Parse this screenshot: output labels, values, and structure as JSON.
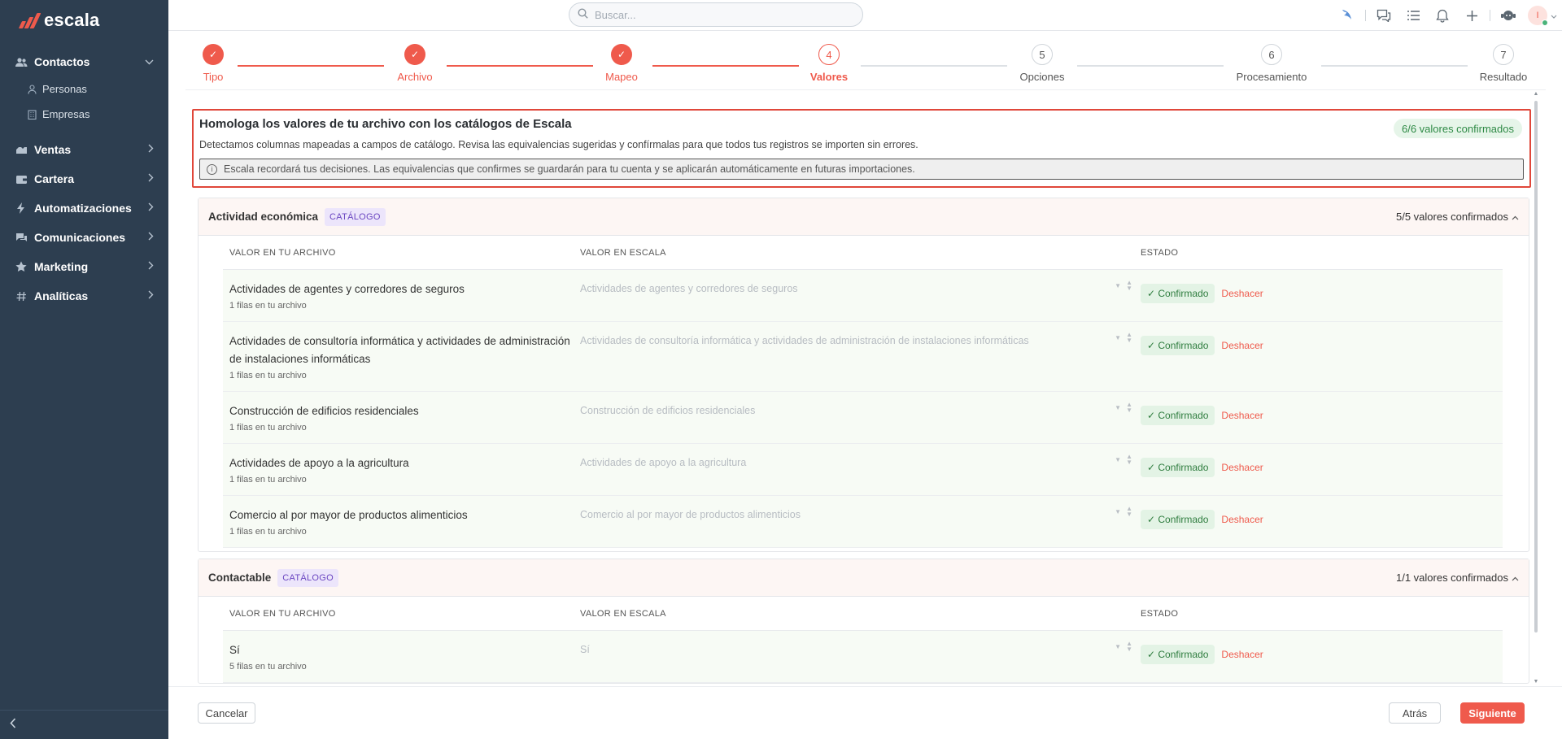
{
  "app": {
    "name": "escala",
    "accent": "#ef5a4c",
    "sidebar_bg": "#2d3e50"
  },
  "sidebar": {
    "items": [
      {
        "label": "Contactos",
        "icon": "users-icon",
        "chevron": "⌄",
        "children": [
          {
            "label": "Personas",
            "icon": "person-icon"
          },
          {
            "label": "Empresas",
            "icon": "building-icon"
          }
        ]
      },
      {
        "label": "Ventas",
        "icon": "handshake-icon",
        "chevron": "›"
      },
      {
        "label": "Cartera",
        "icon": "wallet-icon",
        "chevron": "›"
      },
      {
        "label": "Automatizaciones",
        "icon": "bolt-icon",
        "chevron": "›"
      },
      {
        "label": "Comunicaciones",
        "icon": "chat-icon",
        "chevron": "›"
      },
      {
        "label": "Marketing",
        "icon": "star-icon",
        "chevron": "›"
      },
      {
        "label": "Analíticas",
        "icon": "hash-icon",
        "chevron": "›"
      }
    ],
    "collapse_glyph": "‹"
  },
  "topbar": {
    "search_placeholder": "Buscar...",
    "avatar_initial": "I"
  },
  "stepper": {
    "steps": [
      {
        "number": "1",
        "label": "Tipo",
        "state": "done"
      },
      {
        "number": "2",
        "label": "Archivo",
        "state": "done"
      },
      {
        "number": "3",
        "label": "Mapeo",
        "state": "done"
      },
      {
        "number": "4",
        "label": "Valores",
        "state": "active"
      },
      {
        "number": "5",
        "label": "Opciones",
        "state": "todo"
      },
      {
        "number": "6",
        "label": "Procesamiento",
        "state": "todo"
      },
      {
        "number": "7",
        "label": "Resultado",
        "state": "todo"
      }
    ],
    "check_glyph": "✓"
  },
  "intro": {
    "title": "Homologa los valores de tu archivo con los catálogos de Escala",
    "description": "Detectamos columnas mapeadas a campos de catálogo. Revisa las equivalencias sugeridas y confírmalas para que todos tus registros se importen sin errores.",
    "badge": "6/6 valores confirmados",
    "note": "Escala recordará tus decisiones. Las equivalencias que confirmes se guardarán para tu cuenta y se aplicarán automáticamente en futuras importaciones."
  },
  "table_headers": {
    "file_value": "VALOR EN TU ARCHIVO",
    "escala_value": "VALOR EN ESCALA",
    "status": "ESTADO"
  },
  "sections": [
    {
      "title": "Actividad económica",
      "tag": "CATÁLOGO",
      "count": "5/5 valores confirmados",
      "rows": [
        {
          "value": "Actividades de agentes y corredores de seguros",
          "rows": "1 filas en tu archivo",
          "escala": "Actividades de agentes y corredores de seguros",
          "status": "✓ Confirmado",
          "undo": "Deshacer"
        },
        {
          "value": "Actividades de consultoría informática y actividades de administración de instalaciones informáticas",
          "rows": "1 filas en tu archivo",
          "escala": "Actividades de consultoría informática y actividades de administración de instalaciones informáticas",
          "status": "✓ Confirmado",
          "undo": "Deshacer"
        },
        {
          "value": "Construcción de edificios residenciales",
          "rows": "1 filas en tu archivo",
          "escala": "Construcción de edificios residenciales",
          "status": "✓ Confirmado",
          "undo": "Deshacer"
        },
        {
          "value": "Actividades de apoyo a la agricultura",
          "rows": "1 filas en tu archivo",
          "escala": "Actividades de apoyo a la agricultura",
          "status": "✓ Confirmado",
          "undo": "Deshacer"
        },
        {
          "value": "Comercio al por mayor de productos alimenticios",
          "rows": "1 filas en tu archivo",
          "escala": "Comercio al por mayor de productos alimenticios",
          "status": "✓ Confirmado",
          "undo": "Deshacer"
        }
      ]
    },
    {
      "title": "Contactable",
      "tag": "CATÁLOGO",
      "count": "1/1 valores confirmados",
      "rows": [
        {
          "value": "Sí",
          "rows": "5 filas en tu archivo",
          "escala": "Sí",
          "status": "✓ Confirmado",
          "undo": "Deshacer"
        }
      ]
    }
  ],
  "footer": {
    "cancel": "Cancelar",
    "back": "Atrás",
    "next": "Siguiente"
  }
}
